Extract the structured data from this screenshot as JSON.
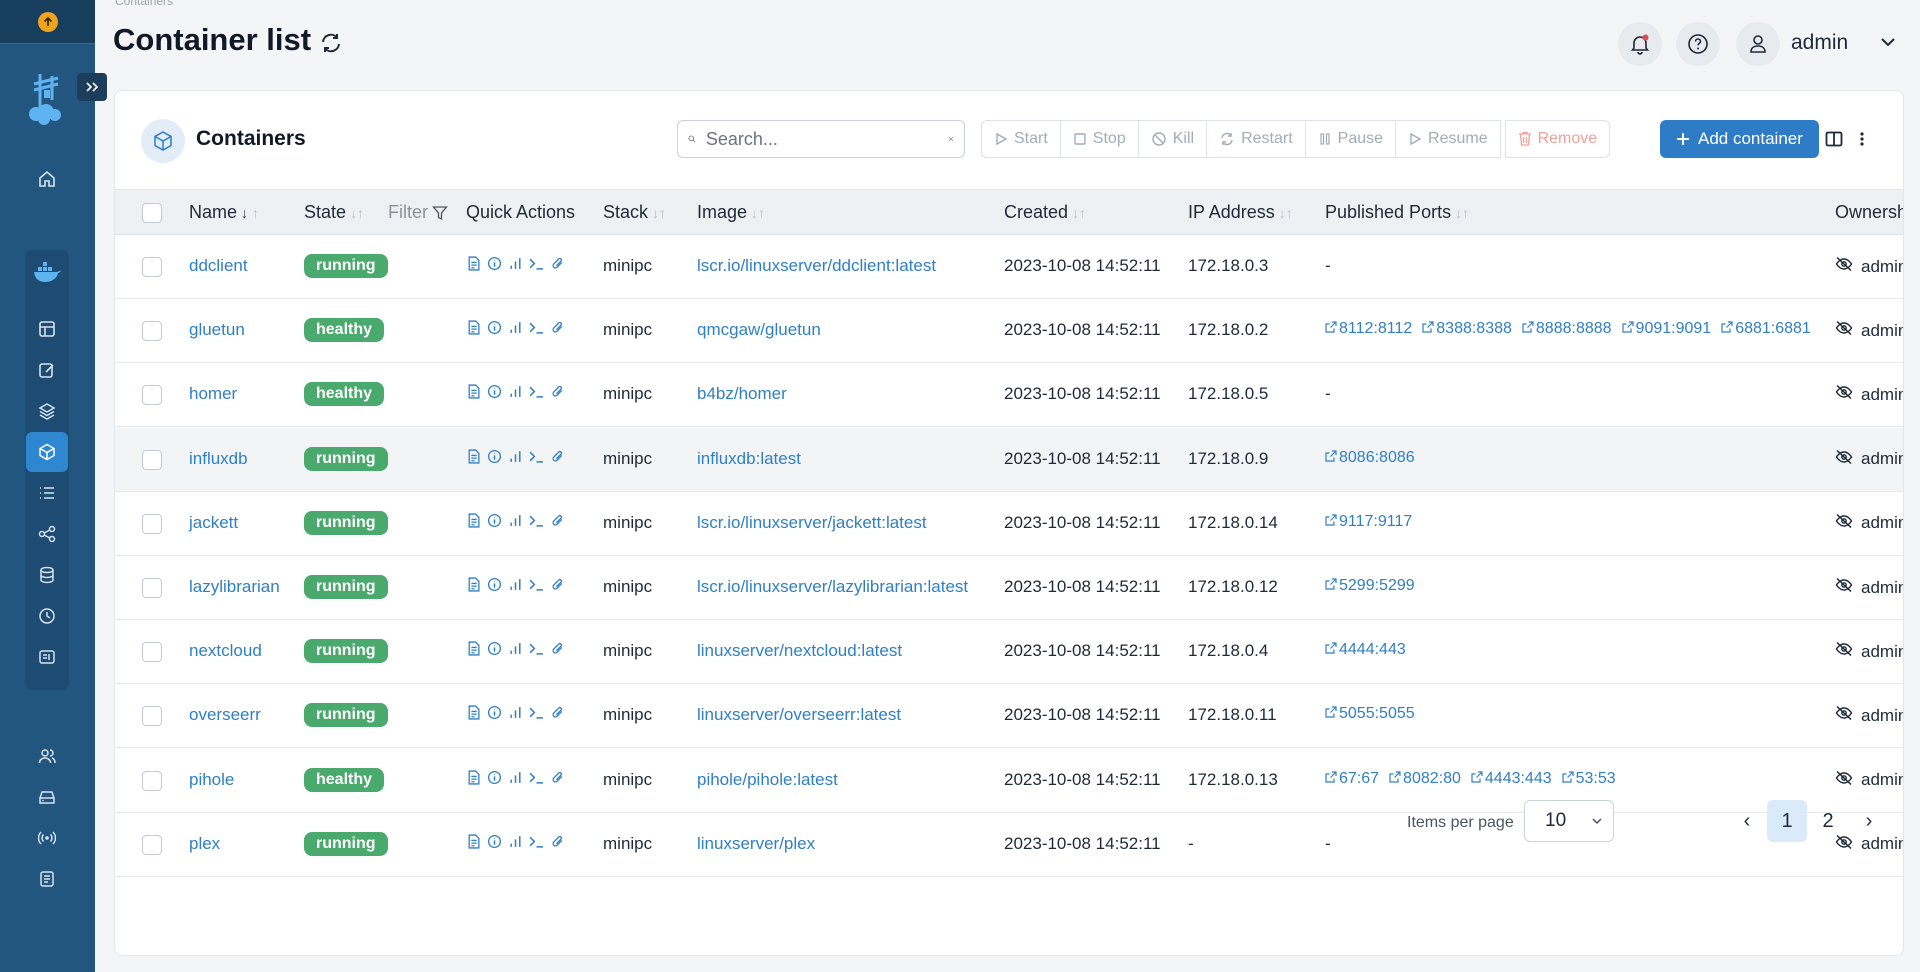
{
  "header": {
    "breadcrumb": "Containers",
    "title": "Container list",
    "user": "admin"
  },
  "card": {
    "title": "Containers",
    "search_placeholder": "Search...",
    "actions": [
      "Start",
      "Stop",
      "Kill",
      "Restart",
      "Pause",
      "Resume"
    ],
    "remove_label": "Remove",
    "add_label": "Add container"
  },
  "columns": {
    "name": "Name",
    "state": "State",
    "filter": "Filter",
    "quick_actions": "Quick Actions",
    "stack": "Stack",
    "image": "Image",
    "created": "Created",
    "ip": "IP Address",
    "ports": "Published Ports",
    "ownership": "Ownership"
  },
  "rows": [
    {
      "name": "ddclient",
      "state": "running",
      "stack": "minipc",
      "image": "lscr.io/linuxserver/ddclient:latest",
      "created": "2023-10-08 14:52:11",
      "ip": "172.18.0.3",
      "ports": [],
      "owner": "admin"
    },
    {
      "name": "gluetun",
      "state": "healthy",
      "stack": "minipc",
      "image": "qmcgaw/gluetun",
      "created": "2023-10-08 14:52:11",
      "ip": "172.18.0.2",
      "ports": [
        "8112:8112",
        "8388:8388",
        "8888:8888",
        "9091:9091",
        "6881:6881"
      ],
      "owner": "admin"
    },
    {
      "name": "homer",
      "state": "healthy",
      "stack": "minipc",
      "image": "b4bz/homer",
      "created": "2023-10-08 14:52:11",
      "ip": "172.18.0.5",
      "ports": [],
      "owner": "admin"
    },
    {
      "name": "influxdb",
      "state": "running",
      "stack": "minipc",
      "image": "influxdb:latest",
      "created": "2023-10-08 14:52:11",
      "ip": "172.18.0.9",
      "ports": [
        "8086:8086"
      ],
      "owner": "admin"
    },
    {
      "name": "jackett",
      "state": "running",
      "stack": "minipc",
      "image": "lscr.io/linuxserver/jackett:latest",
      "created": "2023-10-08 14:52:11",
      "ip": "172.18.0.14",
      "ports": [
        "9117:9117"
      ],
      "owner": "admin"
    },
    {
      "name": "lazylibrarian",
      "state": "running",
      "stack": "minipc",
      "image": "lscr.io/linuxserver/lazylibrarian:latest",
      "created": "2023-10-08 14:52:11",
      "ip": "172.18.0.12",
      "ports": [
        "5299:5299"
      ],
      "owner": "admin"
    },
    {
      "name": "nextcloud",
      "state": "running",
      "stack": "minipc",
      "image": "linuxserver/nextcloud:latest",
      "created": "2023-10-08 14:52:11",
      "ip": "172.18.0.4",
      "ports": [
        "4444:443"
      ],
      "owner": "admin"
    },
    {
      "name": "overseerr",
      "state": "running",
      "stack": "minipc",
      "image": "linuxserver/overseerr:latest",
      "created": "2023-10-08 14:52:11",
      "ip": "172.18.0.11",
      "ports": [
        "5055:5055"
      ],
      "owner": "admin"
    },
    {
      "name": "pihole",
      "state": "healthy",
      "stack": "minipc",
      "image": "pihole/pihole:latest",
      "created": "2023-10-08 14:52:11",
      "ip": "172.18.0.13",
      "ports": [
        "67:67",
        "8082:80",
        "4443:443",
        "53:53"
      ],
      "owner": "admin"
    },
    {
      "name": "plex",
      "state": "running",
      "stack": "minipc",
      "image": "linuxserver/plex",
      "created": "2023-10-08 14:52:11",
      "ip": "-",
      "ports": [],
      "owner": "admin"
    }
  ],
  "empty_ports": "-",
  "pagination": {
    "items_per_page_label": "Items per page",
    "items_per_page": "10",
    "prev": "‹",
    "pages": [
      "1",
      "2"
    ],
    "next": "›"
  },
  "colors": {
    "sidebar": "#23567f",
    "accent": "#2e7bc6",
    "status_green": "#4aa96c",
    "link": "#2f7fc5"
  }
}
